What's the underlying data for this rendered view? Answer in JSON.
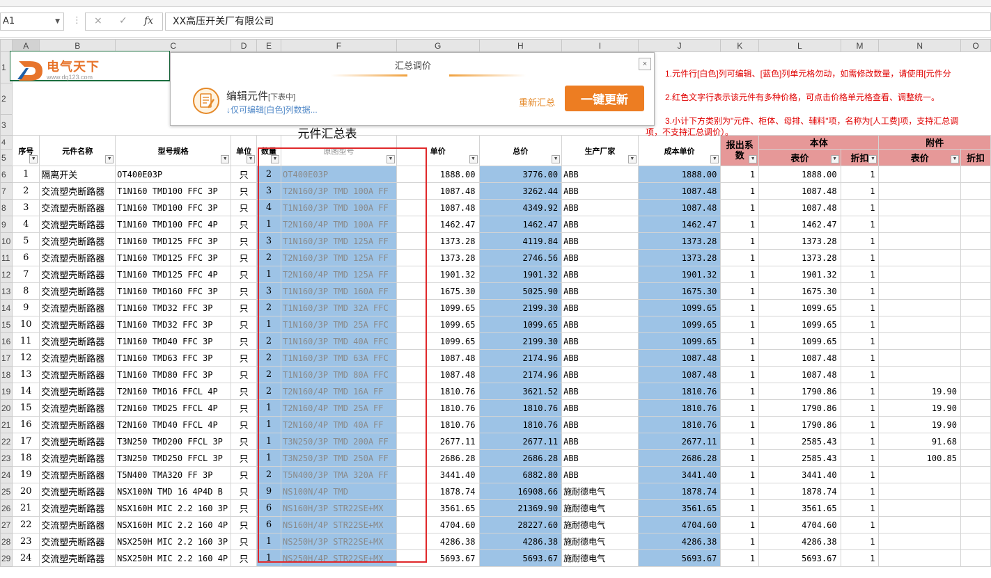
{
  "formula_bar": {
    "name_box": "A1",
    "cancel_icon": "×",
    "enter_icon": "✓",
    "fx_label": "fx",
    "content": "XX高压开关厂有限公司"
  },
  "columns": [
    "A",
    "B",
    "C",
    "D",
    "E",
    "F",
    "G",
    "H",
    "I",
    "J",
    "K",
    "L",
    "M",
    "N",
    "O"
  ],
  "row_numbers": [
    "1",
    "2",
    "3",
    "4",
    "5",
    "6",
    "7",
    "8",
    "9",
    "10",
    "11",
    "12",
    "13",
    "14",
    "15",
    "16",
    "17",
    "18",
    "19",
    "20",
    "21",
    "22",
    "23",
    "24",
    "25",
    "26",
    "27",
    "28",
    "29"
  ],
  "sheet": {
    "logo_text": "电气天下",
    "logo_url": "www.dq123.com",
    "title": "元件汇总表",
    "headers": {
      "seq": "序号",
      "name": "元件名称",
      "model": "型号规格",
      "unit": "单位",
      "qty": "数量",
      "orig_model": "原图型号",
      "unit_price": "单价",
      "total": "总价",
      "maker": "生产厂家",
      "cost_price": "成本单价",
      "quote_coef": "报出系数",
      "body": "本体",
      "body_list": "表价",
      "body_disc": "折扣",
      "acc": "附件",
      "acc_list": "表价",
      "acc_disc": "折扣"
    }
  },
  "dialog": {
    "title": "汇总调价",
    "edit_label": "编辑元件",
    "edit_sub": "[下表中]",
    "edit_hint": "↓仅可编辑[白色]列数据...",
    "resum_link": "重新汇总",
    "update_button": "一键更新",
    "close": "×"
  },
  "notes": {
    "title": "：",
    "n1": "1.元件行[白色]列可编辑、[蓝色]列单元格勿动，如需修改数量，请使用[元件分",
    "n2": "2.红色文字行表示该元件有多种价格，可点击价格单元格查看、调整统一。",
    "n3": "3.小计下方类别为\"元件、柜体、母排、辅料\"项，名称为[人工费]项，支持汇总调",
    "n3b": "项，不支持汇总调价）。"
  },
  "rows": [
    {
      "seq": "1",
      "name": "隔离开关",
      "model": "OT400E03P",
      "unit": "只",
      "qty": "2",
      "orig": "OT400E03P",
      "price": "1888.00",
      "total": "3776.00",
      "maker": "ABB",
      "cost": "1888.00",
      "coef": "1",
      "blist": "1888.00",
      "bdisc": "1",
      "alist": "",
      "adisc": ""
    },
    {
      "seq": "2",
      "name": "交流塑壳断路器",
      "model": "T1N160 TMD100 FFC 3P",
      "unit": "只",
      "qty": "3",
      "orig": "T2N160/3P TMD 100A FF",
      "price": "1087.48",
      "total": "3262.44",
      "maker": "ABB",
      "cost": "1087.48",
      "coef": "1",
      "blist": "1087.48",
      "bdisc": "1",
      "alist": "",
      "adisc": ""
    },
    {
      "seq": "3",
      "name": "交流塑壳断路器",
      "model": "T1N160 TMD100 FFC 3P",
      "unit": "只",
      "qty": "4",
      "orig": "T1N160/3P TMD 100A FF",
      "price": "1087.48",
      "total": "4349.92",
      "maker": "ABB",
      "cost": "1087.48",
      "coef": "1",
      "blist": "1087.48",
      "bdisc": "1",
      "alist": "",
      "adisc": ""
    },
    {
      "seq": "4",
      "name": "交流塑壳断路器",
      "model": "T1N160 TMD100 FFC 4P",
      "unit": "只",
      "qty": "1",
      "orig": "T2N160/4P TMD 100A FF",
      "price": "1462.47",
      "total": "1462.47",
      "maker": "ABB",
      "cost": "1462.47",
      "coef": "1",
      "blist": "1462.47",
      "bdisc": "1",
      "alist": "",
      "adisc": ""
    },
    {
      "seq": "5",
      "name": "交流塑壳断路器",
      "model": "T1N160 TMD125 FFC 3P",
      "unit": "只",
      "qty": "3",
      "orig": "T1N160/3P TMD 125A FF",
      "price": "1373.28",
      "total": "4119.84",
      "maker": "ABB",
      "cost": "1373.28",
      "coef": "1",
      "blist": "1373.28",
      "bdisc": "1",
      "alist": "",
      "adisc": ""
    },
    {
      "seq": "6",
      "name": "交流塑壳断路器",
      "model": "T1N160 TMD125 FFC 3P",
      "unit": "只",
      "qty": "2",
      "orig": "T2N160/3P TMD 125A FF",
      "price": "1373.28",
      "total": "2746.56",
      "maker": "ABB",
      "cost": "1373.28",
      "coef": "1",
      "blist": "1373.28",
      "bdisc": "1",
      "alist": "",
      "adisc": ""
    },
    {
      "seq": "7",
      "name": "交流塑壳断路器",
      "model": "T1N160 TMD125 FFC 4P",
      "unit": "只",
      "qty": "1",
      "orig": "T2N160/4P TMD 125A FF",
      "price": "1901.32",
      "total": "1901.32",
      "maker": "ABB",
      "cost": "1901.32",
      "coef": "1",
      "blist": "1901.32",
      "bdisc": "1",
      "alist": "",
      "adisc": ""
    },
    {
      "seq": "8",
      "name": "交流塑壳断路器",
      "model": "T1N160 TMD160 FFC 3P",
      "unit": "只",
      "qty": "3",
      "orig": "T1N160/3P TMD 160A FF",
      "price": "1675.30",
      "total": "5025.90",
      "maker": "ABB",
      "cost": "1675.30",
      "coef": "1",
      "blist": "1675.30",
      "bdisc": "1",
      "alist": "",
      "adisc": ""
    },
    {
      "seq": "9",
      "name": "交流塑壳断路器",
      "model": "T1N160 TMD32 FFC 3P",
      "unit": "只",
      "qty": "2",
      "orig": "T1N160/3P TMD 32A FFC",
      "price": "1099.65",
      "total": "2199.30",
      "maker": "ABB",
      "cost": "1099.65",
      "coef": "1",
      "blist": "1099.65",
      "bdisc": "1",
      "alist": "",
      "adisc": ""
    },
    {
      "seq": "10",
      "name": "交流塑壳断路器",
      "model": "T1N160 TMD32 FFC 3P",
      "unit": "只",
      "qty": "1",
      "orig": "T1N160/3P TMD 25A FFC",
      "price": "1099.65",
      "total": "1099.65",
      "maker": "ABB",
      "cost": "1099.65",
      "coef": "1",
      "blist": "1099.65",
      "bdisc": "1",
      "alist": "",
      "adisc": ""
    },
    {
      "seq": "11",
      "name": "交流塑壳断路器",
      "model": "T1N160 TMD40 FFC 3P",
      "unit": "只",
      "qty": "2",
      "orig": "T1N160/3P TMD 40A FFC",
      "price": "1099.65",
      "total": "2199.30",
      "maker": "ABB",
      "cost": "1099.65",
      "coef": "1",
      "blist": "1099.65",
      "bdisc": "1",
      "alist": "",
      "adisc": ""
    },
    {
      "seq": "12",
      "name": "交流塑壳断路器",
      "model": "T1N160 TMD63 FFC 3P",
      "unit": "只",
      "qty": "2",
      "orig": "T1N160/3P TMD 63A FFC",
      "price": "1087.48",
      "total": "2174.96",
      "maker": "ABB",
      "cost": "1087.48",
      "coef": "1",
      "blist": "1087.48",
      "bdisc": "1",
      "alist": "",
      "adisc": ""
    },
    {
      "seq": "13",
      "name": "交流塑壳断路器",
      "model": "T1N160 TMD80 FFC 3P",
      "unit": "只",
      "qty": "2",
      "orig": "T1N160/3P TMD 80A FFC",
      "price": "1087.48",
      "total": "2174.96",
      "maker": "ABB",
      "cost": "1087.48",
      "coef": "1",
      "blist": "1087.48",
      "bdisc": "1",
      "alist": "",
      "adisc": ""
    },
    {
      "seq": "14",
      "name": "交流塑壳断路器",
      "model": "T2N160 TMD16 FFCL 4P",
      "unit": "只",
      "qty": "2",
      "orig": "T2N160/4P TMD 16A FF",
      "price": "1810.76",
      "total": "3621.52",
      "maker": "ABB",
      "cost": "1810.76",
      "coef": "1",
      "blist": "1790.86",
      "bdisc": "1",
      "alist": "19.90",
      "adisc": ""
    },
    {
      "seq": "15",
      "name": "交流塑壳断路器",
      "model": "T2N160 TMD25 FFCL 4P",
      "unit": "只",
      "qty": "1",
      "orig": "T2N160/4P TMD 25A FF",
      "price": "1810.76",
      "total": "1810.76",
      "maker": "ABB",
      "cost": "1810.76",
      "coef": "1",
      "blist": "1790.86",
      "bdisc": "1",
      "alist": "19.90",
      "adisc": ""
    },
    {
      "seq": "16",
      "name": "交流塑壳断路器",
      "model": "T2N160 TMD40 FFCL 4P",
      "unit": "只",
      "qty": "1",
      "orig": "T2N160/4P TMD 40A FF",
      "price": "1810.76",
      "total": "1810.76",
      "maker": "ABB",
      "cost": "1810.76",
      "coef": "1",
      "blist": "1790.86",
      "bdisc": "1",
      "alist": "19.90",
      "adisc": ""
    },
    {
      "seq": "17",
      "name": "交流塑壳断路器",
      "model": "T3N250 TMD200 FFCL 3P",
      "unit": "只",
      "qty": "1",
      "orig": "T3N250/3P TMD 200A FF",
      "price": "2677.11",
      "total": "2677.11",
      "maker": "ABB",
      "cost": "2677.11",
      "coef": "1",
      "blist": "2585.43",
      "bdisc": "1",
      "alist": "91.68",
      "adisc": ""
    },
    {
      "seq": "18",
      "name": "交流塑壳断路器",
      "model": "T3N250 TMD250 FFCL 3P",
      "unit": "只",
      "qty": "1",
      "orig": "T3N250/3P TMD 250A FF",
      "price": "2686.28",
      "total": "2686.28",
      "maker": "ABB",
      "cost": "2686.28",
      "coef": "1",
      "blist": "2585.43",
      "bdisc": "1",
      "alist": "100.85",
      "adisc": ""
    },
    {
      "seq": "19",
      "name": "交流塑壳断路器",
      "model": "T5N400 TMA320 FF 3P",
      "unit": "只",
      "qty": "2",
      "orig": "T5N400/3P TMA 320A FF",
      "price": "3441.40",
      "total": "6882.80",
      "maker": "ABB",
      "cost": "3441.40",
      "coef": "1",
      "blist": "3441.40",
      "bdisc": "1",
      "alist": "",
      "adisc": ""
    },
    {
      "seq": "20",
      "name": "交流塑壳断路器",
      "model": "NSX100N TMD 16 4P4D B",
      "unit": "只",
      "qty": "9",
      "orig": "NS100N/4P TMD",
      "price": "1878.74",
      "total": "16908.66",
      "maker": "施耐德电气",
      "cost": "1878.74",
      "coef": "1",
      "blist": "1878.74",
      "bdisc": "1",
      "alist": "",
      "adisc": ""
    },
    {
      "seq": "21",
      "name": "交流塑壳断路器",
      "model": "NSX160H MIC 2.2 160 3P",
      "unit": "只",
      "qty": "6",
      "orig": "NS160H/3P STR22SE+MX",
      "price": "3561.65",
      "total": "21369.90",
      "maker": "施耐德电气",
      "cost": "3561.65",
      "coef": "1",
      "blist": "3561.65",
      "bdisc": "1",
      "alist": "",
      "adisc": ""
    },
    {
      "seq": "22",
      "name": "交流塑壳断路器",
      "model": "NSX160H MIC 2.2 160 4P",
      "unit": "只",
      "qty": "6",
      "orig": "NS160H/4P STR22SE+MX",
      "price": "4704.60",
      "total": "28227.60",
      "maker": "施耐德电气",
      "cost": "4704.60",
      "coef": "1",
      "blist": "4704.60",
      "bdisc": "1",
      "alist": "",
      "adisc": ""
    },
    {
      "seq": "23",
      "name": "交流塑壳断路器",
      "model": "NSX250H MIC 2.2 160 3P",
      "unit": "只",
      "qty": "1",
      "orig": "NS250H/3P STR22SE+MX",
      "price": "4286.38",
      "total": "4286.38",
      "maker": "施耐德电气",
      "cost": "4286.38",
      "coef": "1",
      "blist": "4286.38",
      "bdisc": "1",
      "alist": "",
      "adisc": ""
    },
    {
      "seq": "24",
      "name": "交流塑壳断路器",
      "model": "NSX250H MIC 2.2 160 4P",
      "unit": "只",
      "qty": "1",
      "orig": "NS250H/4P STR22SE+MX",
      "price": "5693.67",
      "total": "5693.67",
      "maker": "施耐德电气",
      "cost": "5693.67",
      "coef": "1",
      "blist": "5693.67",
      "bdisc": "1",
      "alist": "",
      "adisc": ""
    }
  ],
  "colors": {
    "accent_orange": "#ed7d22",
    "blue_col": "#9dc3e6",
    "pink_header": "#e69898",
    "red_note": "#e00000",
    "red_box": "#e0282a"
  }
}
